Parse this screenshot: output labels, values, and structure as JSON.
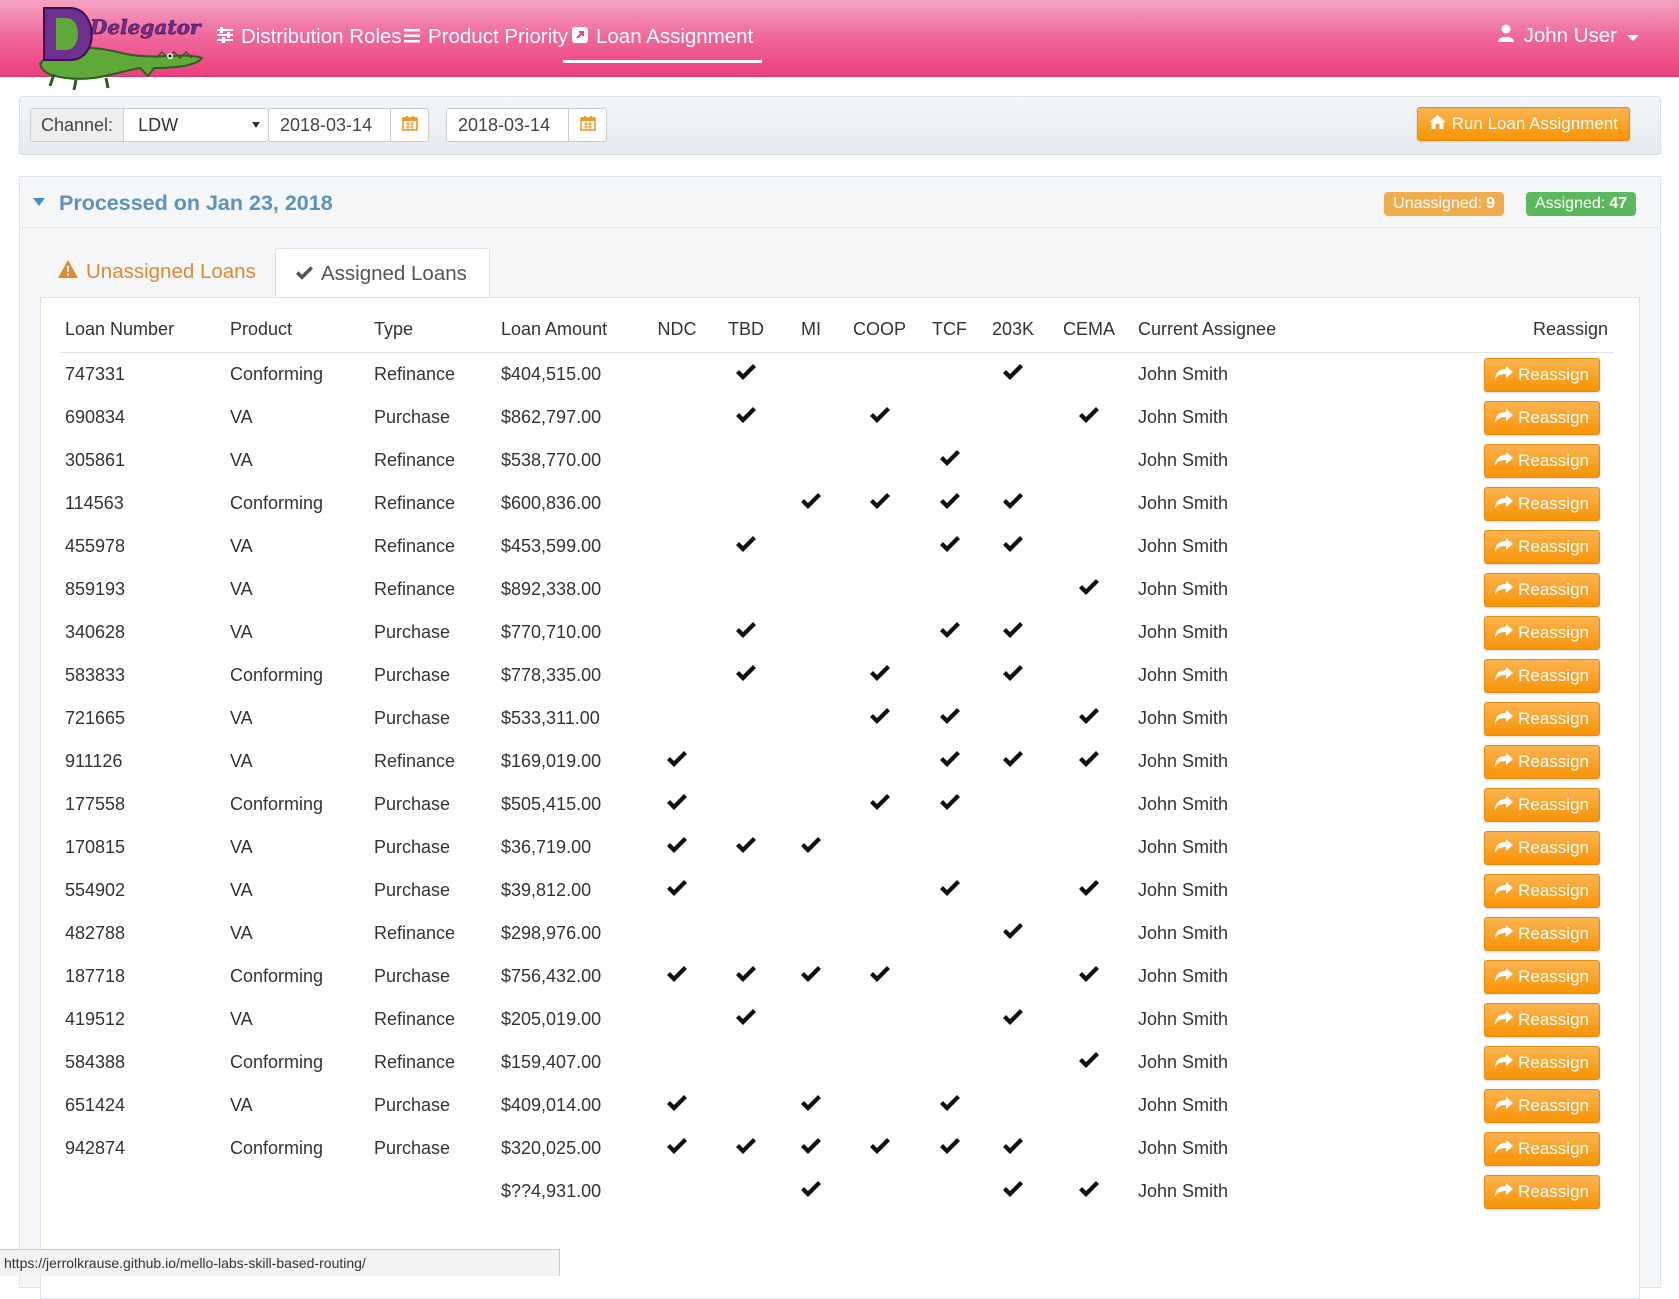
{
  "app": {
    "logo_text": "Delegator",
    "nav": [
      {
        "label": "Distribution Roles",
        "icon": "sliders-icon"
      },
      {
        "label": "Product Priority",
        "icon": "list-icon"
      },
      {
        "label": "Loan Assignment",
        "icon": "external-link-icon",
        "active": true
      }
    ],
    "user": {
      "name": "John User",
      "icon": "user-icon"
    }
  },
  "filters": {
    "channel_label": "Channel:",
    "channel_value": "LDW",
    "start_date": "2018-03-14",
    "end_date": "2018-03-14",
    "run_button": "Run Loan Assignment"
  },
  "panel": {
    "title": "Processed on Jan 23, 2018",
    "unassigned_badge_label": "Unassigned:",
    "unassigned_count": "9",
    "assigned_badge_label": "Assigned:",
    "assigned_count": "47"
  },
  "tabs": {
    "unassigned": "Unassigned Loans",
    "assigned": "Assigned Loans"
  },
  "table": {
    "columns": [
      "Loan Number",
      "Product",
      "Type",
      "Loan Amount",
      "NDC",
      "TBD",
      "MI",
      "COOP",
      "TCF",
      "203K",
      "CEMA",
      "Current Assignee",
      "Reassign"
    ],
    "reassign_label": "Reassign",
    "rows": [
      {
        "loan": "747331",
        "product": "Conforming",
        "type": "Refinance",
        "amount": "$404,515.00",
        "flags": [
          0,
          1,
          0,
          0,
          0,
          1,
          0
        ],
        "assignee": "John Smith"
      },
      {
        "loan": "690834",
        "product": "VA",
        "type": "Purchase",
        "amount": "$862,797.00",
        "flags": [
          0,
          1,
          0,
          1,
          0,
          0,
          1
        ],
        "assignee": "John Smith"
      },
      {
        "loan": "305861",
        "product": "VA",
        "type": "Refinance",
        "amount": "$538,770.00",
        "flags": [
          0,
          0,
          0,
          0,
          1,
          0,
          0
        ],
        "assignee": "John Smith"
      },
      {
        "loan": "114563",
        "product": "Conforming",
        "type": "Refinance",
        "amount": "$600,836.00",
        "flags": [
          0,
          0,
          1,
          1,
          1,
          1,
          0
        ],
        "assignee": "John Smith"
      },
      {
        "loan": "455978",
        "product": "VA",
        "type": "Refinance",
        "amount": "$453,599.00",
        "flags": [
          0,
          1,
          0,
          0,
          1,
          1,
          0
        ],
        "assignee": "John Smith"
      },
      {
        "loan": "859193",
        "product": "VA",
        "type": "Refinance",
        "amount": "$892,338.00",
        "flags": [
          0,
          0,
          0,
          0,
          0,
          0,
          1
        ],
        "assignee": "John Smith"
      },
      {
        "loan": "340628",
        "product": "VA",
        "type": "Purchase",
        "amount": "$770,710.00",
        "flags": [
          0,
          1,
          0,
          0,
          1,
          1,
          0
        ],
        "assignee": "John Smith"
      },
      {
        "loan": "583833",
        "product": "Conforming",
        "type": "Purchase",
        "amount": "$778,335.00",
        "flags": [
          0,
          1,
          0,
          1,
          0,
          1,
          0
        ],
        "assignee": "John Smith"
      },
      {
        "loan": "721665",
        "product": "VA",
        "type": "Purchase",
        "amount": "$533,311.00",
        "flags": [
          0,
          0,
          0,
          1,
          1,
          0,
          1
        ],
        "assignee": "John Smith"
      },
      {
        "loan": "911126",
        "product": "VA",
        "type": "Refinance",
        "amount": "$169,019.00",
        "flags": [
          1,
          0,
          0,
          0,
          1,
          1,
          1
        ],
        "assignee": "John Smith"
      },
      {
        "loan": "177558",
        "product": "Conforming",
        "type": "Purchase",
        "amount": "$505,415.00",
        "flags": [
          1,
          0,
          0,
          1,
          1,
          0,
          0
        ],
        "assignee": "John Smith"
      },
      {
        "loan": "170815",
        "product": "VA",
        "type": "Purchase",
        "amount": "$36,719.00",
        "flags": [
          1,
          1,
          1,
          0,
          0,
          0,
          0
        ],
        "assignee": "John Smith"
      },
      {
        "loan": "554902",
        "product": "VA",
        "type": "Purchase",
        "amount": "$39,812.00",
        "flags": [
          1,
          0,
          0,
          0,
          1,
          0,
          1
        ],
        "assignee": "John Smith"
      },
      {
        "loan": "482788",
        "product": "VA",
        "type": "Refinance",
        "amount": "$298,976.00",
        "flags": [
          0,
          0,
          0,
          0,
          0,
          1,
          0
        ],
        "assignee": "John Smith"
      },
      {
        "loan": "187718",
        "product": "Conforming",
        "type": "Purchase",
        "amount": "$756,432.00",
        "flags": [
          1,
          1,
          1,
          1,
          0,
          0,
          1
        ],
        "assignee": "John Smith"
      },
      {
        "loan": "419512",
        "product": "VA",
        "type": "Refinance",
        "amount": "$205,019.00",
        "flags": [
          0,
          1,
          0,
          0,
          0,
          1,
          0
        ],
        "assignee": "John Smith"
      },
      {
        "loan": "584388",
        "product": "Conforming",
        "type": "Refinance",
        "amount": "$159,407.00",
        "flags": [
          0,
          0,
          0,
          0,
          0,
          0,
          1
        ],
        "assignee": "John Smith"
      },
      {
        "loan": "651424",
        "product": "VA",
        "type": "Purchase",
        "amount": "$409,014.00",
        "flags": [
          1,
          0,
          1,
          0,
          1,
          0,
          0
        ],
        "assignee": "John Smith"
      },
      {
        "loan": "942874",
        "product": "Conforming",
        "type": "Purchase",
        "amount": "$320,025.00",
        "flags": [
          1,
          1,
          1,
          1,
          1,
          1,
          0
        ],
        "assignee": "John Smith"
      },
      {
        "loan": "",
        "product": "",
        "type": "",
        "amount": "$??4,931.00",
        "flags": [
          0,
          0,
          1,
          0,
          0,
          1,
          1
        ],
        "assignee": "John Smith"
      }
    ]
  },
  "status_bar": {
    "url": "https://jerrolkrause.github.io/mello-labs-skill-based-routing/"
  },
  "colors": {
    "navbar": "#eb3f7f",
    "accent_orange": "#f89406",
    "success_green": "#5cb85c",
    "warning_orange": "#f0ad4e",
    "title_blue": "#5b92bf"
  }
}
